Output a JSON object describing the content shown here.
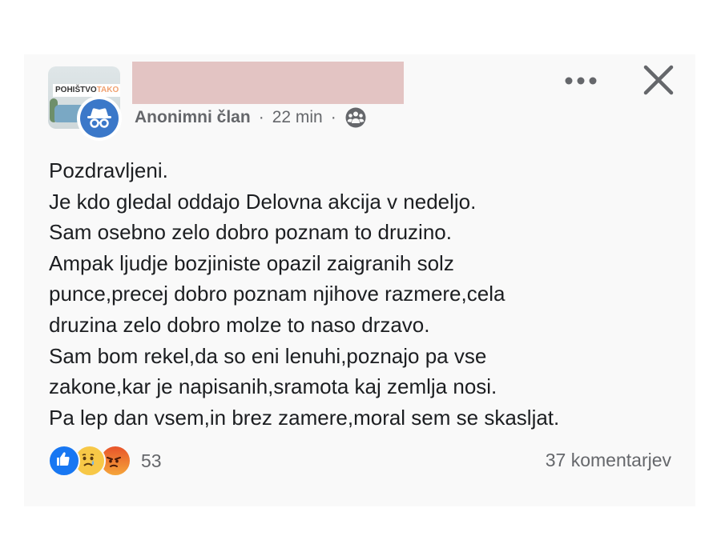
{
  "group": {
    "avatar_text_bold": "POHIŠTVO",
    "avatar_text_light": "TAKO"
  },
  "post": {
    "author": "Anonimni član",
    "time": "22 min",
    "separator": "·",
    "audience_icon": "group-icon",
    "lines": [
      "Pozdravljeni.",
      "Je kdo gledal oddajo Delovna akcija v nedeljo.",
      "Sam osebno zelo dobro poznam to druzino.",
      "Ampak ljudje bozjiniste opazil zaigranih solz",
      "punce,precej dobro poznam njihove razmere,cela",
      "druzina zelo dobro molze to naso drzavo.",
      "Sam bom rekel,da so eni lenuhi,poznajo pa vse",
      "zakone,kar je napisanih,sramota kaj zemlja nosi.",
      "Pa lep dan vsem,in brez zamere,moral sem se skasljat."
    ]
  },
  "footer": {
    "reaction_count": "53",
    "comments": "37 komentarjev",
    "reactions": [
      "like",
      "sad",
      "angry"
    ]
  },
  "colors": {
    "text": "#1c1e21",
    "muted": "#65676b",
    "like": "#1877f2",
    "redaction": "#e3c4c3"
  }
}
